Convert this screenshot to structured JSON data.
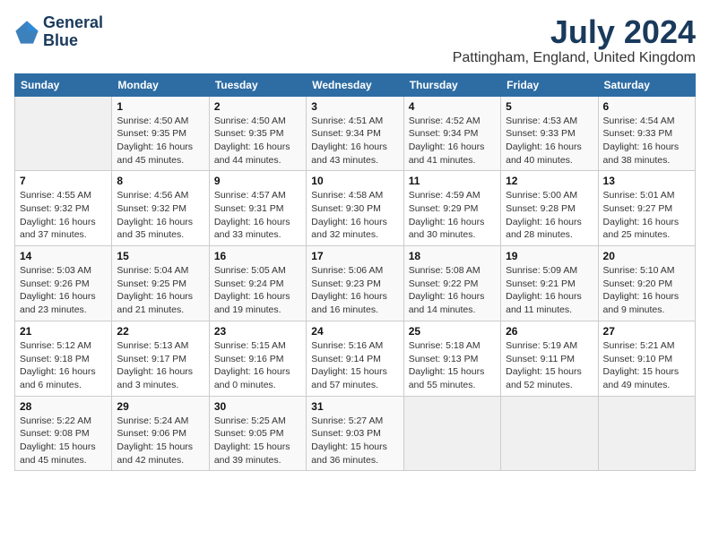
{
  "header": {
    "logo_line1": "General",
    "logo_line2": "Blue",
    "month_year": "July 2024",
    "location": "Pattingham, England, United Kingdom"
  },
  "weekdays": [
    "Sunday",
    "Monday",
    "Tuesday",
    "Wednesday",
    "Thursday",
    "Friday",
    "Saturday"
  ],
  "weeks": [
    [
      {
        "day": "",
        "info": ""
      },
      {
        "day": "1",
        "info": "Sunrise: 4:50 AM\nSunset: 9:35 PM\nDaylight: 16 hours\nand 45 minutes."
      },
      {
        "day": "2",
        "info": "Sunrise: 4:50 AM\nSunset: 9:35 PM\nDaylight: 16 hours\nand 44 minutes."
      },
      {
        "day": "3",
        "info": "Sunrise: 4:51 AM\nSunset: 9:34 PM\nDaylight: 16 hours\nand 43 minutes."
      },
      {
        "day": "4",
        "info": "Sunrise: 4:52 AM\nSunset: 9:34 PM\nDaylight: 16 hours\nand 41 minutes."
      },
      {
        "day": "5",
        "info": "Sunrise: 4:53 AM\nSunset: 9:33 PM\nDaylight: 16 hours\nand 40 minutes."
      },
      {
        "day": "6",
        "info": "Sunrise: 4:54 AM\nSunset: 9:33 PM\nDaylight: 16 hours\nand 38 minutes."
      }
    ],
    [
      {
        "day": "7",
        "info": "Sunrise: 4:55 AM\nSunset: 9:32 PM\nDaylight: 16 hours\nand 37 minutes."
      },
      {
        "day": "8",
        "info": "Sunrise: 4:56 AM\nSunset: 9:32 PM\nDaylight: 16 hours\nand 35 minutes."
      },
      {
        "day": "9",
        "info": "Sunrise: 4:57 AM\nSunset: 9:31 PM\nDaylight: 16 hours\nand 33 minutes."
      },
      {
        "day": "10",
        "info": "Sunrise: 4:58 AM\nSunset: 9:30 PM\nDaylight: 16 hours\nand 32 minutes."
      },
      {
        "day": "11",
        "info": "Sunrise: 4:59 AM\nSunset: 9:29 PM\nDaylight: 16 hours\nand 30 minutes."
      },
      {
        "day": "12",
        "info": "Sunrise: 5:00 AM\nSunset: 9:28 PM\nDaylight: 16 hours\nand 28 minutes."
      },
      {
        "day": "13",
        "info": "Sunrise: 5:01 AM\nSunset: 9:27 PM\nDaylight: 16 hours\nand 25 minutes."
      }
    ],
    [
      {
        "day": "14",
        "info": "Sunrise: 5:03 AM\nSunset: 9:26 PM\nDaylight: 16 hours\nand 23 minutes."
      },
      {
        "day": "15",
        "info": "Sunrise: 5:04 AM\nSunset: 9:25 PM\nDaylight: 16 hours\nand 21 minutes."
      },
      {
        "day": "16",
        "info": "Sunrise: 5:05 AM\nSunset: 9:24 PM\nDaylight: 16 hours\nand 19 minutes."
      },
      {
        "day": "17",
        "info": "Sunrise: 5:06 AM\nSunset: 9:23 PM\nDaylight: 16 hours\nand 16 minutes."
      },
      {
        "day": "18",
        "info": "Sunrise: 5:08 AM\nSunset: 9:22 PM\nDaylight: 16 hours\nand 14 minutes."
      },
      {
        "day": "19",
        "info": "Sunrise: 5:09 AM\nSunset: 9:21 PM\nDaylight: 16 hours\nand 11 minutes."
      },
      {
        "day": "20",
        "info": "Sunrise: 5:10 AM\nSunset: 9:20 PM\nDaylight: 16 hours\nand 9 minutes."
      }
    ],
    [
      {
        "day": "21",
        "info": "Sunrise: 5:12 AM\nSunset: 9:18 PM\nDaylight: 16 hours\nand 6 minutes."
      },
      {
        "day": "22",
        "info": "Sunrise: 5:13 AM\nSunset: 9:17 PM\nDaylight: 16 hours\nand 3 minutes."
      },
      {
        "day": "23",
        "info": "Sunrise: 5:15 AM\nSunset: 9:16 PM\nDaylight: 16 hours\nand 0 minutes."
      },
      {
        "day": "24",
        "info": "Sunrise: 5:16 AM\nSunset: 9:14 PM\nDaylight: 15 hours\nand 57 minutes."
      },
      {
        "day": "25",
        "info": "Sunrise: 5:18 AM\nSunset: 9:13 PM\nDaylight: 15 hours\nand 55 minutes."
      },
      {
        "day": "26",
        "info": "Sunrise: 5:19 AM\nSunset: 9:11 PM\nDaylight: 15 hours\nand 52 minutes."
      },
      {
        "day": "27",
        "info": "Sunrise: 5:21 AM\nSunset: 9:10 PM\nDaylight: 15 hours\nand 49 minutes."
      }
    ],
    [
      {
        "day": "28",
        "info": "Sunrise: 5:22 AM\nSunset: 9:08 PM\nDaylight: 15 hours\nand 45 minutes."
      },
      {
        "day": "29",
        "info": "Sunrise: 5:24 AM\nSunset: 9:06 PM\nDaylight: 15 hours\nand 42 minutes."
      },
      {
        "day": "30",
        "info": "Sunrise: 5:25 AM\nSunset: 9:05 PM\nDaylight: 15 hours\nand 39 minutes."
      },
      {
        "day": "31",
        "info": "Sunrise: 5:27 AM\nSunset: 9:03 PM\nDaylight: 15 hours\nand 36 minutes."
      },
      {
        "day": "",
        "info": ""
      },
      {
        "day": "",
        "info": ""
      },
      {
        "day": "",
        "info": ""
      }
    ]
  ]
}
